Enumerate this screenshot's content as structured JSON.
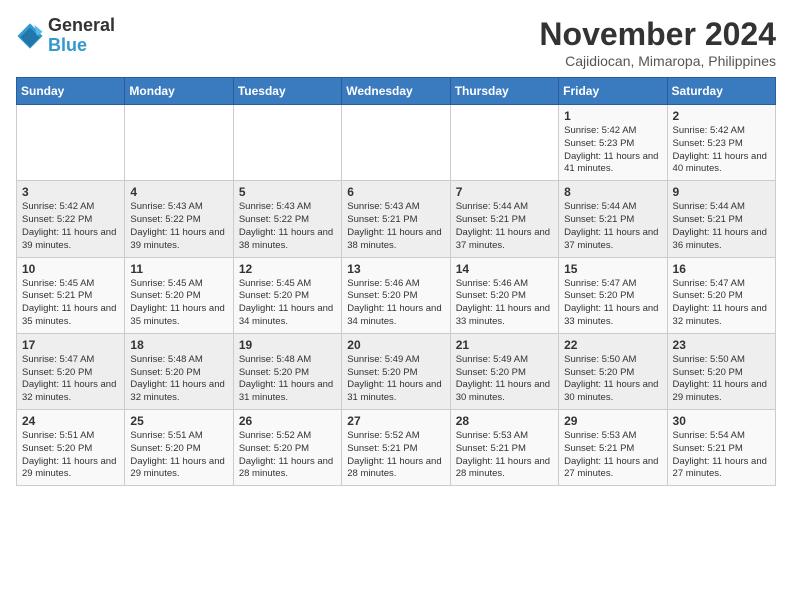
{
  "header": {
    "logo_general": "General",
    "logo_blue": "Blue",
    "month": "November 2024",
    "location": "Cajidiocan, Mimaropa, Philippines"
  },
  "weekdays": [
    "Sunday",
    "Monday",
    "Tuesday",
    "Wednesday",
    "Thursday",
    "Friday",
    "Saturday"
  ],
  "weeks": [
    [
      {
        "day": "",
        "info": ""
      },
      {
        "day": "",
        "info": ""
      },
      {
        "day": "",
        "info": ""
      },
      {
        "day": "",
        "info": ""
      },
      {
        "day": "",
        "info": ""
      },
      {
        "day": "1",
        "info": "Sunrise: 5:42 AM\nSunset: 5:23 PM\nDaylight: 11 hours and 41 minutes."
      },
      {
        "day": "2",
        "info": "Sunrise: 5:42 AM\nSunset: 5:23 PM\nDaylight: 11 hours and 40 minutes."
      }
    ],
    [
      {
        "day": "3",
        "info": "Sunrise: 5:42 AM\nSunset: 5:22 PM\nDaylight: 11 hours and 39 minutes."
      },
      {
        "day": "4",
        "info": "Sunrise: 5:43 AM\nSunset: 5:22 PM\nDaylight: 11 hours and 39 minutes."
      },
      {
        "day": "5",
        "info": "Sunrise: 5:43 AM\nSunset: 5:22 PM\nDaylight: 11 hours and 38 minutes."
      },
      {
        "day": "6",
        "info": "Sunrise: 5:43 AM\nSunset: 5:21 PM\nDaylight: 11 hours and 38 minutes."
      },
      {
        "day": "7",
        "info": "Sunrise: 5:44 AM\nSunset: 5:21 PM\nDaylight: 11 hours and 37 minutes."
      },
      {
        "day": "8",
        "info": "Sunrise: 5:44 AM\nSunset: 5:21 PM\nDaylight: 11 hours and 37 minutes."
      },
      {
        "day": "9",
        "info": "Sunrise: 5:44 AM\nSunset: 5:21 PM\nDaylight: 11 hours and 36 minutes."
      }
    ],
    [
      {
        "day": "10",
        "info": "Sunrise: 5:45 AM\nSunset: 5:21 PM\nDaylight: 11 hours and 35 minutes."
      },
      {
        "day": "11",
        "info": "Sunrise: 5:45 AM\nSunset: 5:20 PM\nDaylight: 11 hours and 35 minutes."
      },
      {
        "day": "12",
        "info": "Sunrise: 5:45 AM\nSunset: 5:20 PM\nDaylight: 11 hours and 34 minutes."
      },
      {
        "day": "13",
        "info": "Sunrise: 5:46 AM\nSunset: 5:20 PM\nDaylight: 11 hours and 34 minutes."
      },
      {
        "day": "14",
        "info": "Sunrise: 5:46 AM\nSunset: 5:20 PM\nDaylight: 11 hours and 33 minutes."
      },
      {
        "day": "15",
        "info": "Sunrise: 5:47 AM\nSunset: 5:20 PM\nDaylight: 11 hours and 33 minutes."
      },
      {
        "day": "16",
        "info": "Sunrise: 5:47 AM\nSunset: 5:20 PM\nDaylight: 11 hours and 32 minutes."
      }
    ],
    [
      {
        "day": "17",
        "info": "Sunrise: 5:47 AM\nSunset: 5:20 PM\nDaylight: 11 hours and 32 minutes."
      },
      {
        "day": "18",
        "info": "Sunrise: 5:48 AM\nSunset: 5:20 PM\nDaylight: 11 hours and 32 minutes."
      },
      {
        "day": "19",
        "info": "Sunrise: 5:48 AM\nSunset: 5:20 PM\nDaylight: 11 hours and 31 minutes."
      },
      {
        "day": "20",
        "info": "Sunrise: 5:49 AM\nSunset: 5:20 PM\nDaylight: 11 hours and 31 minutes."
      },
      {
        "day": "21",
        "info": "Sunrise: 5:49 AM\nSunset: 5:20 PM\nDaylight: 11 hours and 30 minutes."
      },
      {
        "day": "22",
        "info": "Sunrise: 5:50 AM\nSunset: 5:20 PM\nDaylight: 11 hours and 30 minutes."
      },
      {
        "day": "23",
        "info": "Sunrise: 5:50 AM\nSunset: 5:20 PM\nDaylight: 11 hours and 29 minutes."
      }
    ],
    [
      {
        "day": "24",
        "info": "Sunrise: 5:51 AM\nSunset: 5:20 PM\nDaylight: 11 hours and 29 minutes."
      },
      {
        "day": "25",
        "info": "Sunrise: 5:51 AM\nSunset: 5:20 PM\nDaylight: 11 hours and 29 minutes."
      },
      {
        "day": "26",
        "info": "Sunrise: 5:52 AM\nSunset: 5:20 PM\nDaylight: 11 hours and 28 minutes."
      },
      {
        "day": "27",
        "info": "Sunrise: 5:52 AM\nSunset: 5:21 PM\nDaylight: 11 hours and 28 minutes."
      },
      {
        "day": "28",
        "info": "Sunrise: 5:53 AM\nSunset: 5:21 PM\nDaylight: 11 hours and 28 minutes."
      },
      {
        "day": "29",
        "info": "Sunrise: 5:53 AM\nSunset: 5:21 PM\nDaylight: 11 hours and 27 minutes."
      },
      {
        "day": "30",
        "info": "Sunrise: 5:54 AM\nSunset: 5:21 PM\nDaylight: 11 hours and 27 minutes."
      }
    ]
  ]
}
